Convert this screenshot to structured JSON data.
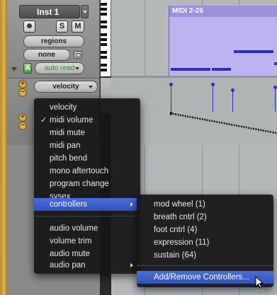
{
  "track": {
    "name": "Inst 1",
    "solo_label": "S",
    "mute_label": "M",
    "regions_label": "regions",
    "none_label": "none",
    "auto_label": "auto read",
    "auto_icon_label": "A",
    "velocity_label": "velocity"
  },
  "region": {
    "title": "MIDI 2-26",
    "color": "#bdb3ef"
  },
  "main_menu": {
    "items": [
      {
        "label": "velocity",
        "checked": false
      },
      {
        "label": "midi volume",
        "checked": true
      },
      {
        "label": "midi mute",
        "checked": false
      },
      {
        "label": "midi pan",
        "checked": false
      },
      {
        "label": "pitch bend",
        "checked": false
      },
      {
        "label": "mono aftertouch",
        "checked": false
      },
      {
        "label": "program change",
        "checked": false
      },
      {
        "label": "sysex",
        "checked": false
      },
      {
        "label": "controllers",
        "checked": false,
        "submenu": true,
        "highlighted": true
      },
      {
        "label": "audio volume",
        "checked": false
      },
      {
        "label": "volume trim",
        "checked": false
      },
      {
        "label": "audio mute",
        "checked": false
      },
      {
        "label": "audio pan",
        "checked": false,
        "submenu": true
      }
    ],
    "check_mark": "✓"
  },
  "sub_menu": {
    "items": [
      {
        "label": "mod wheel (1)"
      },
      {
        "label": "breath cntrl (2)"
      },
      {
        "label": "foot cntrl (4)"
      },
      {
        "label": "expression (11)"
      },
      {
        "label": "sustain (64)"
      },
      {
        "label": "Add/Remove Controllers...",
        "highlighted": true
      }
    ]
  },
  "colors": {
    "highlight": "#2e52c2",
    "note": "#2a2fbe",
    "track_strip": "#e3b24a"
  }
}
